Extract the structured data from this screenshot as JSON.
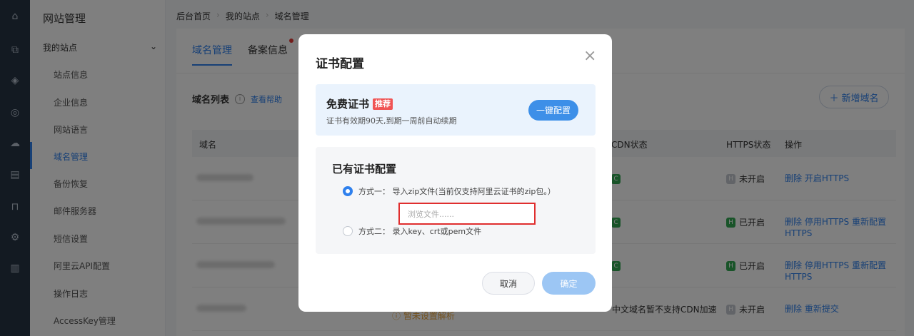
{
  "rail_icons": [
    "home-icon",
    "copy-icon",
    "layers-icon",
    "compass-icon",
    "chat-icon",
    "list-icon",
    "bag-icon",
    "gear-icon",
    "trash-icon"
  ],
  "sidebar": {
    "title": "网站管理",
    "group": "我的站点",
    "items": [
      "站点信息",
      "企业信息",
      "网站语言",
      "域名管理",
      "备份恢复",
      "邮件服务器",
      "短信设置",
      "阿里云API配置",
      "操作日志",
      "AccessKey管理"
    ],
    "active_index": 3
  },
  "breadcrumb": [
    "后台首页",
    "我的站点",
    "域名管理"
  ],
  "tabs": [
    "域名管理",
    "备案信息"
  ],
  "list": {
    "title": "域名列表",
    "help": "查看帮助",
    "add_button": "新增域名",
    "columns": [
      "域名",
      "CDN状态",
      "HTTPS状态",
      "操作"
    ]
  },
  "rows": [
    {
      "https": "未开启",
      "https_on": false,
      "ops": "删除  开启HTTPS"
    },
    {
      "https": "已开启",
      "https_on": true,
      "ops": "删除  停用HTTPS  重新配置HTTPS"
    },
    {
      "https": "已开启",
      "https_on": true,
      "ops": "删除  停用HTTPS  重新配置HTTPS"
    },
    {
      "https": "未开启",
      "https_on": false,
      "ops": "删除  重新提交",
      "cdn_text": "中文域名暂不支持CDN加速",
      "warn": "暂未设置解析"
    }
  ],
  "dialog": {
    "title": "证书配置",
    "free": {
      "title": "免费证书",
      "tag": "推荐",
      "desc": "证书有效期90天,到期一周前自动续期",
      "button": "一键配置"
    },
    "existing": {
      "title": "已有证书配置",
      "option1": "方式一：  导入zip文件(当前仅支持阿里云证书的zip包。）",
      "browse_placeholder": "浏览文件......",
      "option2": "方式二：  录入key、crt或pem文件",
      "selected": "option1"
    },
    "cancel": "取消",
    "ok": "确定"
  },
  "colors": {
    "accent": "#2f80ed",
    "rail": "#263445",
    "danger": "#e02e2e",
    "success": "#33a852"
  }
}
